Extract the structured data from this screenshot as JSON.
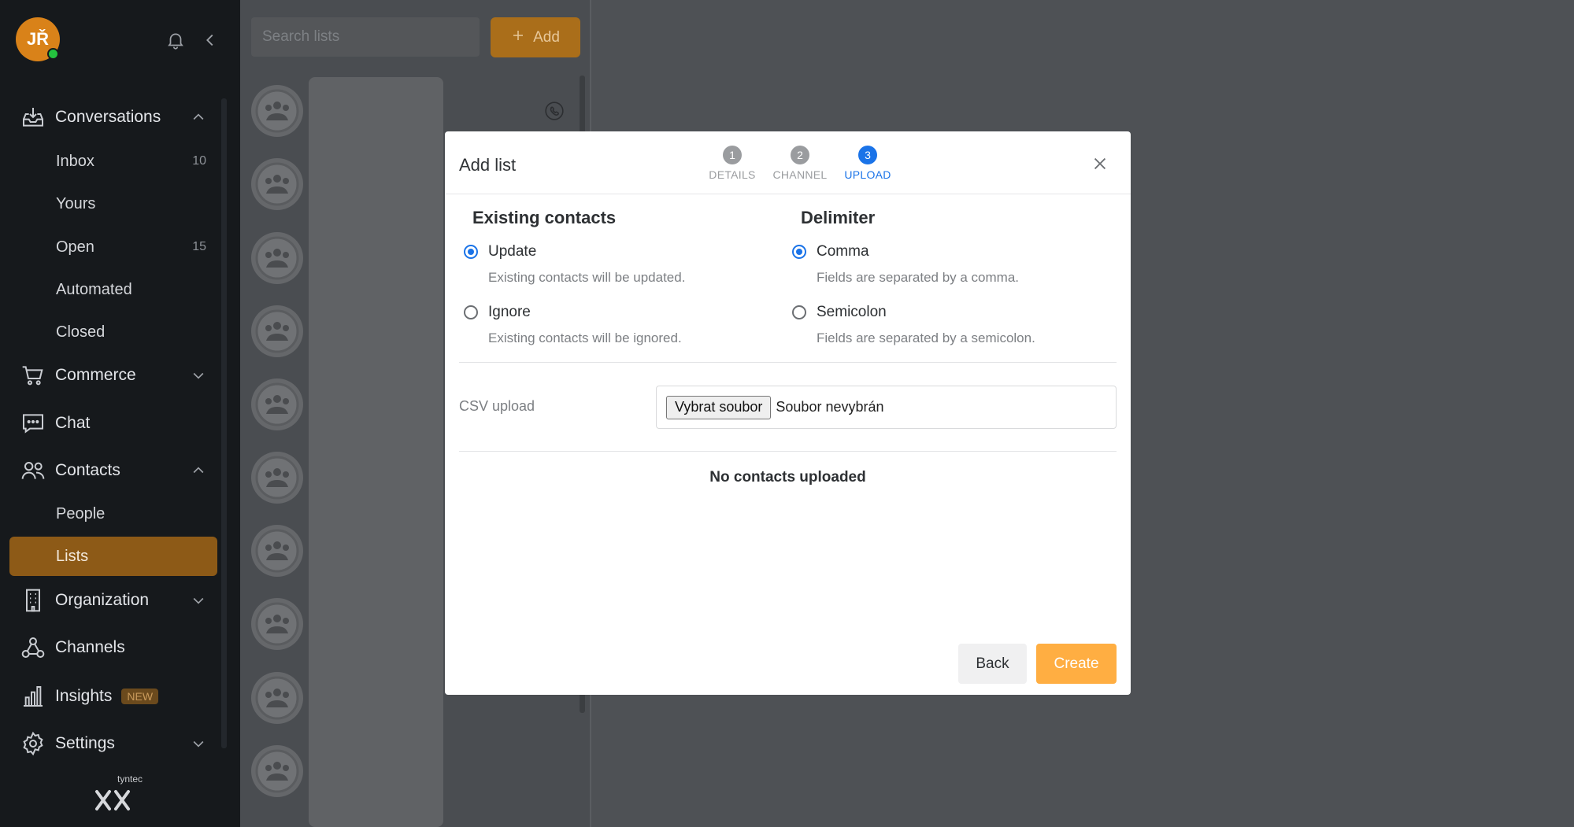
{
  "user": {
    "initials": "JŘ",
    "status": "online"
  },
  "sidebar": {
    "sections": [
      {
        "label": "Conversations",
        "icon": "inbox-tray-icon",
        "expanded": true
      },
      {
        "label": "Commerce",
        "icon": "cart-icon",
        "expanded": false
      },
      {
        "label": "Chat",
        "icon": "chat-bubble-icon"
      },
      {
        "label": "Contacts",
        "icon": "people-icon",
        "expanded": true
      },
      {
        "label": "Organization",
        "icon": "building-icon",
        "expanded": false
      },
      {
        "label": "Channels",
        "icon": "network-icon"
      },
      {
        "label": "Insights",
        "icon": "bar-chart-icon",
        "badge": "NEW"
      },
      {
        "label": "Settings",
        "icon": "gear-icon",
        "expanded": false
      }
    ],
    "conversation_items": [
      {
        "label": "Inbox",
        "count": "10"
      },
      {
        "label": "Yours",
        "count": ""
      },
      {
        "label": "Open",
        "count": "15"
      },
      {
        "label": "Automated",
        "count": ""
      },
      {
        "label": "Closed",
        "count": ""
      }
    ],
    "contact_items": [
      {
        "label": "People"
      },
      {
        "label": "Lists",
        "active": true
      }
    ],
    "brand": "tyntec"
  },
  "lists": {
    "search_placeholder": "Search lists",
    "add_label": "Add"
  },
  "modal": {
    "title": "Add list",
    "steps": [
      {
        "num": "1",
        "label": "DETAILS"
      },
      {
        "num": "2",
        "label": "CHANNEL"
      },
      {
        "num": "3",
        "label": "UPLOAD",
        "active": true
      }
    ],
    "existing_contacts": {
      "title": "Existing contacts",
      "options": [
        {
          "label": "Update",
          "hint": "Existing contacts will be updated.",
          "selected": true
        },
        {
          "label": "Ignore",
          "hint": "Existing contacts will be ignored.",
          "selected": false
        }
      ]
    },
    "delimiter": {
      "title": "Delimiter",
      "options": [
        {
          "label": "Comma",
          "hint": "Fields are separated by a comma.",
          "selected": true
        },
        {
          "label": "Semicolon",
          "hint": "Fields are separated by a semicolon.",
          "selected": false
        }
      ]
    },
    "csv_label": "CSV upload",
    "file_button": "Vybrat soubor",
    "file_status": "Soubor nevybrán",
    "empty_message": "No contacts uploaded",
    "back_label": "Back",
    "create_label": "Create"
  },
  "colors": {
    "accent": "#ffae42",
    "active_nav": "#8d5a17",
    "primary_blue": "#1a73e8",
    "sidebar_bg": "#16191c"
  }
}
